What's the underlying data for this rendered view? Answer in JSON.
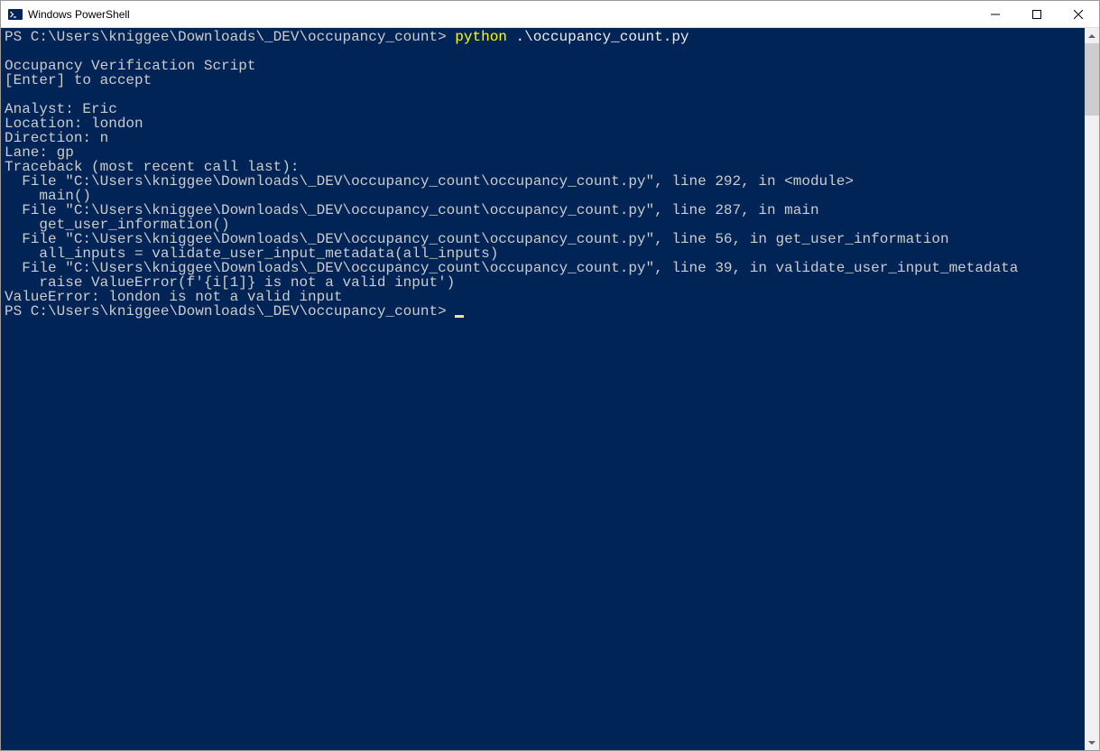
{
  "window": {
    "title": "Windows PowerShell"
  },
  "terminal": {
    "prompt1": "PS C:\\Users\\kniggee\\Downloads\\_DEV\\occupancy_count> ",
    "command1_python": "python",
    "command1_args": " .\\occupancy_count.py",
    "blank1": "",
    "line_title": "Occupancy Verification Script",
    "line_enter": "[Enter] to accept",
    "blank2": "",
    "line_analyst": "Analyst: Eric",
    "line_location": "Location: london",
    "line_direction": "Direction: n",
    "line_lane": "Lane: gp",
    "line_traceback": "Traceback (most recent call last):",
    "line_file1": "  File \"C:\\Users\\kniggee\\Downloads\\_DEV\\occupancy_count\\occupancy_count.py\", line 292, in <module>",
    "line_main": "    main()",
    "line_file2": "  File \"C:\\Users\\kniggee\\Downloads\\_DEV\\occupancy_count\\occupancy_count.py\", line 287, in main",
    "line_getuser": "    get_user_information()",
    "line_file3": "  File \"C:\\Users\\kniggee\\Downloads\\_DEV\\occupancy_count\\occupancy_count.py\", line 56, in get_user_information",
    "line_allinputs": "    all_inputs = validate_user_input_metadata(all_inputs)",
    "line_file4": "  File \"C:\\Users\\kniggee\\Downloads\\_DEV\\occupancy_count\\occupancy_count.py\", line 39, in validate_user_input_metadata",
    "line_raise": "    raise ValueError(f'{i[1]} is not a valid input')",
    "line_error": "ValueError: london is not a valid input",
    "prompt2": "PS C:\\Users\\kniggee\\Downloads\\_DEV\\occupancy_count> "
  }
}
